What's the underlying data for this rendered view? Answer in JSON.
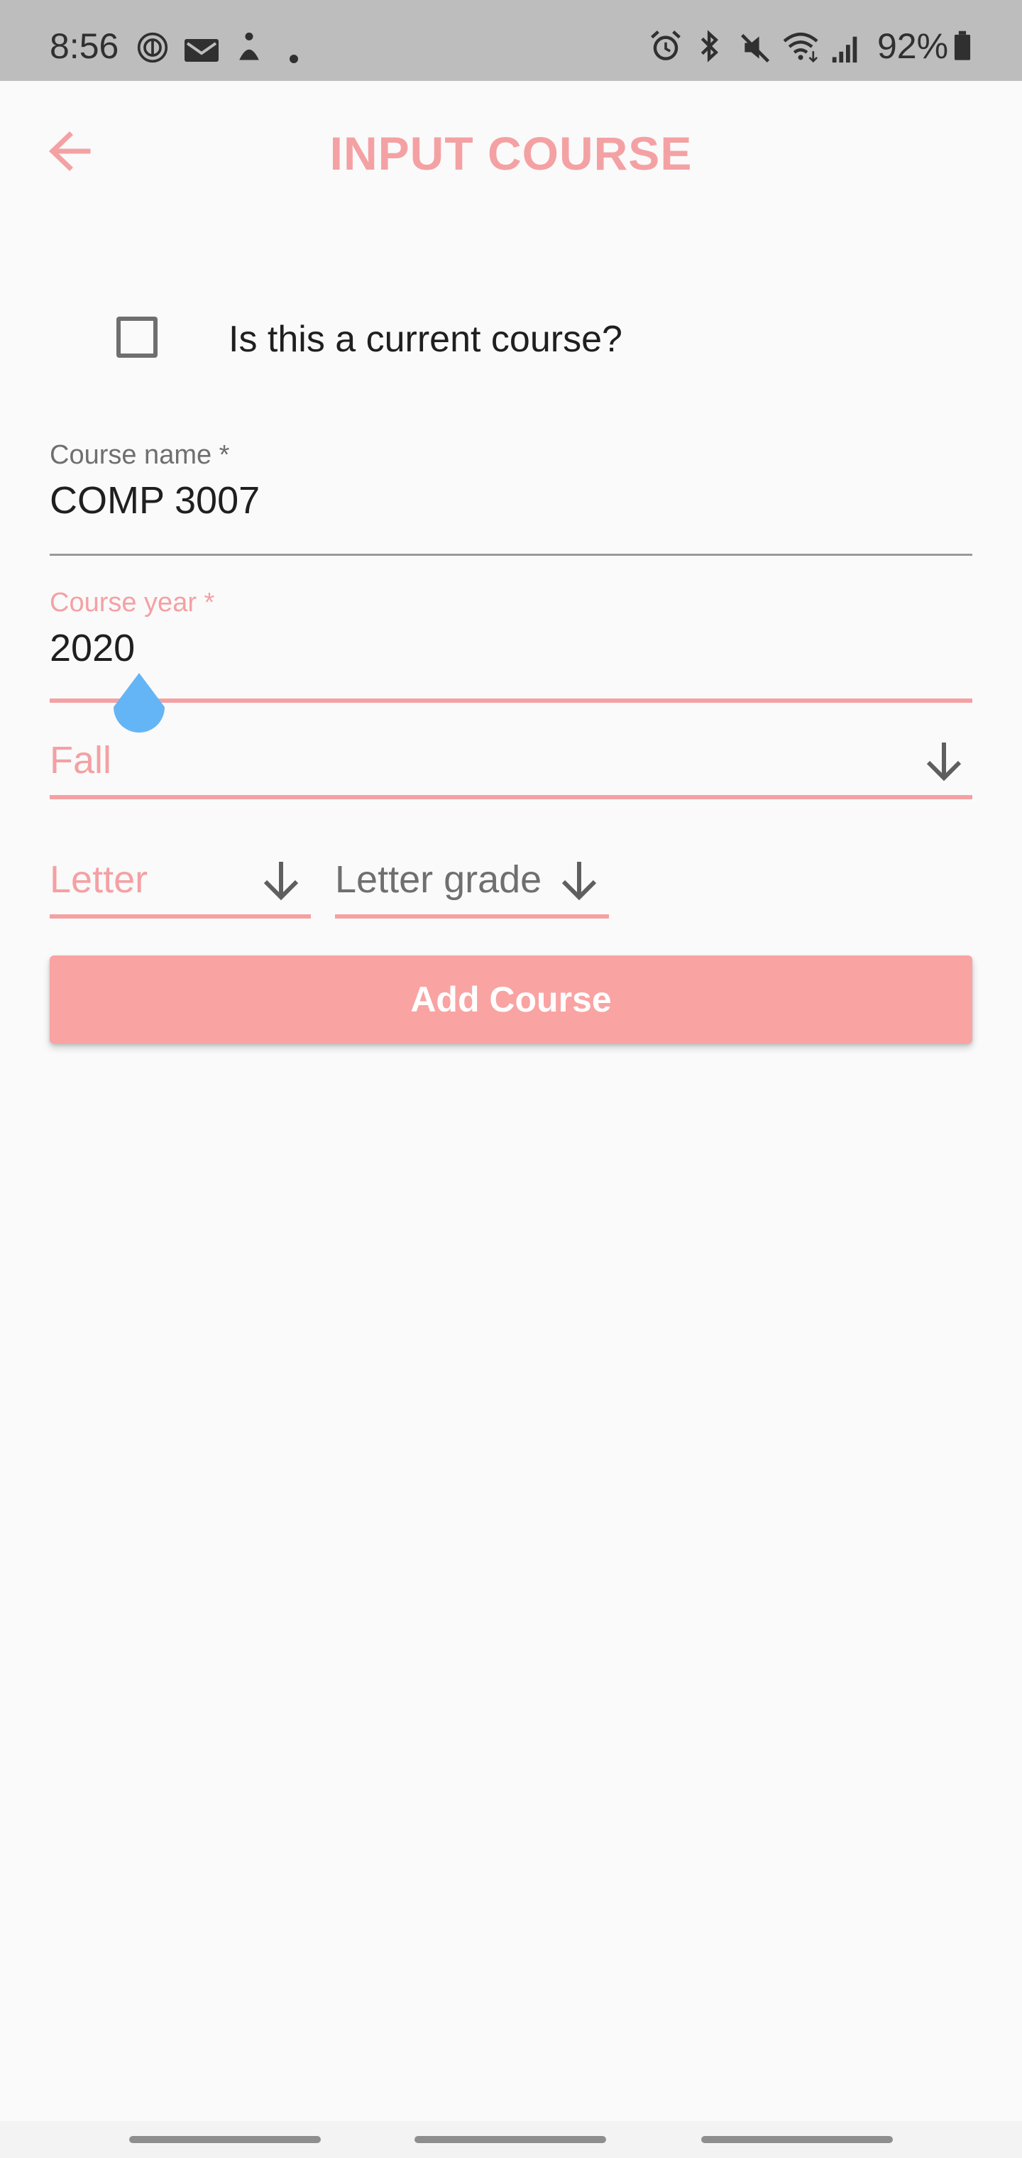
{
  "status_bar": {
    "time": "8:56",
    "battery": "92%",
    "left_icons": [
      "data-saver-icon",
      "mail-icon",
      "accessibility-icon",
      "dot-icon"
    ],
    "right_icons": [
      "alarm-icon",
      "bluetooth-icon",
      "mute-icon",
      "wifi-icon",
      "signal-icon",
      "battery-icon"
    ]
  },
  "app_bar": {
    "title": "INPUT COURSE",
    "back_icon": "arrow-left-icon"
  },
  "form": {
    "current_course": {
      "label": "Is this a current course?",
      "checked": false
    },
    "course_name": {
      "label": "Course name *",
      "value": "COMP 3007"
    },
    "course_year": {
      "label": "Course year *",
      "value": "2020"
    },
    "term": {
      "value": "Fall"
    },
    "grade_type": {
      "value": "Letter"
    },
    "letter_grade": {
      "placeholder": "Letter grade"
    },
    "submit_label": "Add Course"
  },
  "colors": {
    "accent": "#f4a1a4",
    "button": "#f9a3a3",
    "cursor_handle": "#64b5f6",
    "status_bar": "#bdbdbd",
    "background": "#fafafa"
  }
}
